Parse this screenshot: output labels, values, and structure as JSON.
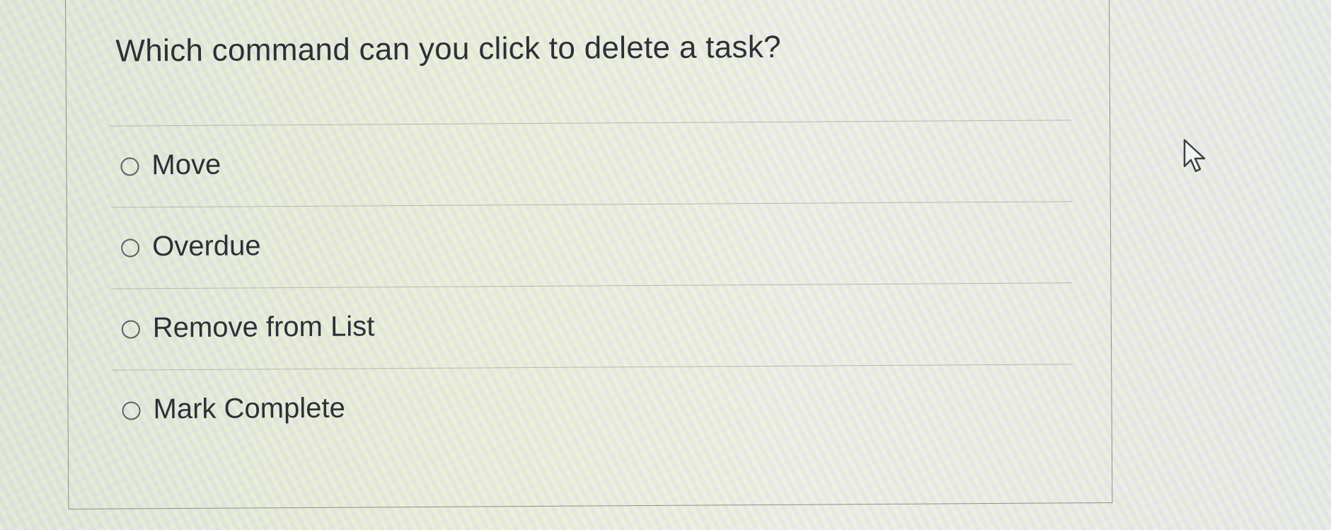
{
  "question": {
    "text": "Which command can you click to delete a task?"
  },
  "answers": [
    {
      "label": "Move",
      "selected": false
    },
    {
      "label": "Overdue",
      "selected": false
    },
    {
      "label": "Remove from List",
      "selected": false
    },
    {
      "label": "Mark Complete",
      "selected": false
    }
  ],
  "icons": {
    "radio": "radio-unselected-icon",
    "cursor": "mouse-pointer-icon"
  }
}
